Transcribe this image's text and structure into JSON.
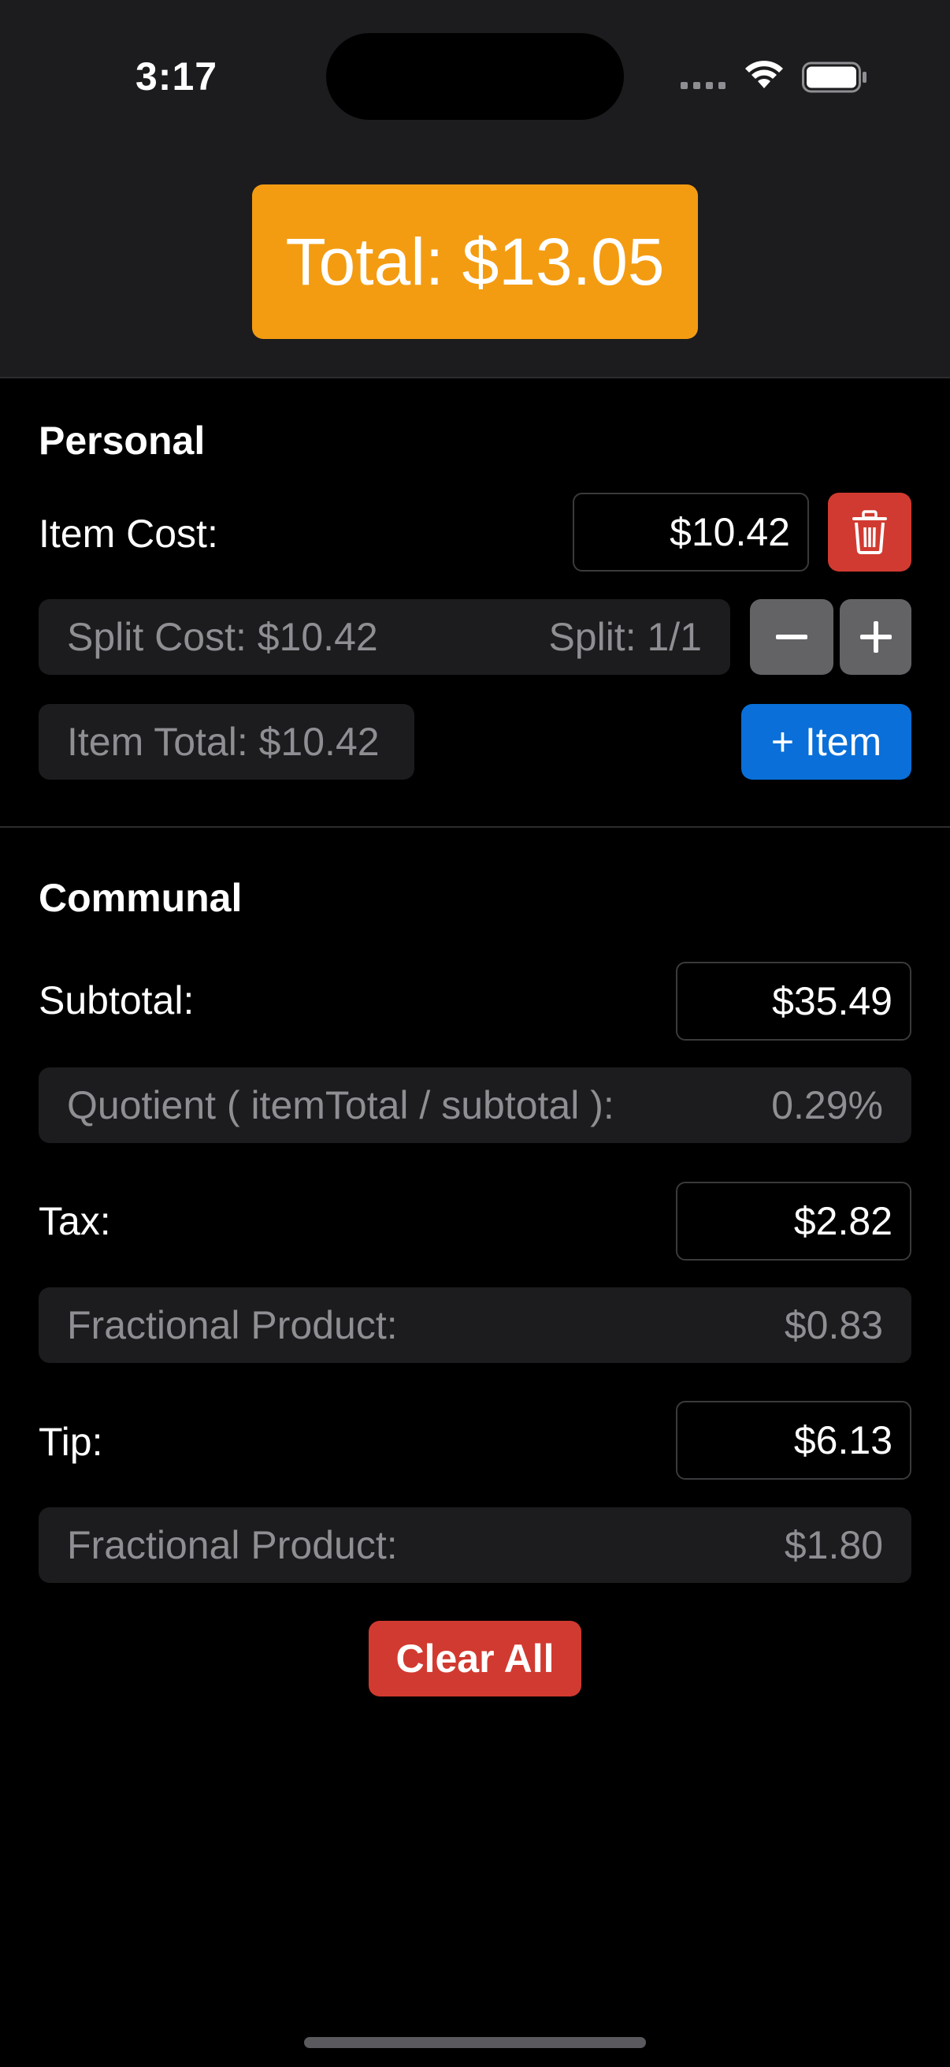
{
  "status_bar": {
    "time": "3:17"
  },
  "header": {
    "total_label": "Total: $13.05",
    "total_color": "#f39c12"
  },
  "personal": {
    "title": "Personal",
    "item_cost_label": "Item Cost:",
    "item_cost_value": "$10.42",
    "split_cost": "Split Cost: $10.42",
    "split_ratio": "Split: 1/1",
    "item_total": "Item Total: $10.42",
    "add_item_label": "+ Item",
    "delete_icon": "trash-icon",
    "decrement_icon": "minus-icon",
    "increment_icon": "plus-icon"
  },
  "communal": {
    "title": "Communal",
    "subtotal_label": "Subtotal:",
    "subtotal_value": "$35.49",
    "quotient_label": "Quotient ( itemTotal / subtotal ):",
    "quotient_value": "0.29%",
    "tax_label": "Tax:",
    "tax_value": "$2.82",
    "tax_fraction_label": "Fractional Product:",
    "tax_fraction_value": "$0.83",
    "tip_label": "Tip:",
    "tip_value": "$6.13",
    "tip_fraction_label": "Fractional Product:",
    "tip_fraction_value": "$1.80"
  },
  "actions": {
    "clear_all_label": "Clear All",
    "clear_color": "#d13a30",
    "add_color": "#0a6fd8"
  }
}
